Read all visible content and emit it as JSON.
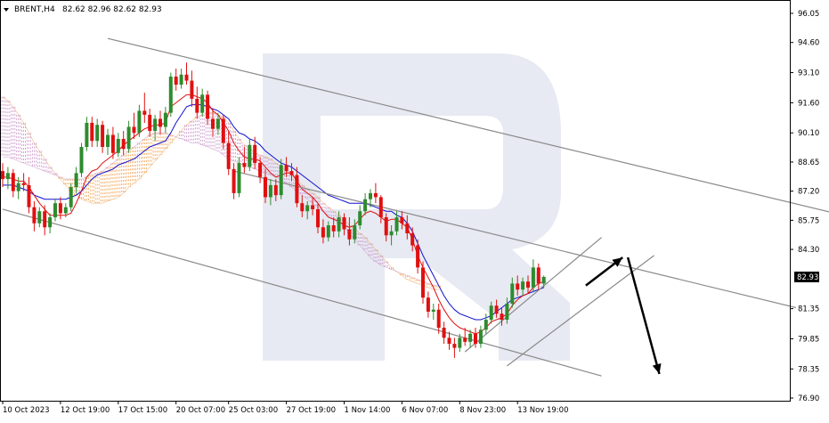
{
  "header": {
    "symbol_label": "BRENT,H4",
    "ohlc": "82.62 82.96 82.62 82.93"
  },
  "colors": {
    "bull": "#2e8b2e",
    "bear": "#e01010",
    "tenkan": "#e01010",
    "kijun": "#1010d0",
    "cloud_up": "#c890c8",
    "cloud_down": "#f0a050",
    "channel": "#8a8a8a",
    "arrow": "#000000",
    "watermark": "#dfe3ee",
    "axis": "#000000",
    "price_box": "#000000"
  },
  "icons": {
    "dropdown": "dropdown-triangle-icon"
  },
  "chart_data": {
    "type": "candlestick",
    "symbol": "BRENT",
    "timeframe": "H4",
    "ylim": [
      76.9,
      96.05
    ],
    "y_ticks": [
      "96.05",
      "94.60",
      "93.10",
      "91.60",
      "90.10",
      "88.65",
      "87.20",
      "85.75",
      "84.30",
      "82.93",
      "81.35",
      "79.85",
      "78.35",
      "76.90"
    ],
    "x_ticks": [
      "10 Oct 2023",
      "12 Oct 19:00",
      "17 Oct 15:00",
      "20 Oct 07:00",
      "25 Oct 03:00",
      "27 Oct 19:00",
      "1 Nov 14:00",
      "6 Nov 07:00",
      "8 Nov 23:00",
      "13 Nov 19:00"
    ],
    "current_price": "82.93",
    "candles": [
      {
        "o": 88.2,
        "h": 88.6,
        "l": 87.4,
        "c": 87.8
      },
      {
        "o": 87.8,
        "h": 88.4,
        "l": 87.3,
        "c": 88.1
      },
      {
        "o": 88.1,
        "h": 88.3,
        "l": 86.9,
        "c": 87.2
      },
      {
        "o": 87.2,
        "h": 87.9,
        "l": 86.8,
        "c": 87.6
      },
      {
        "o": 87.6,
        "h": 88.1,
        "l": 87.2,
        "c": 87.5
      },
      {
        "o": 87.5,
        "h": 87.9,
        "l": 86.1,
        "c": 86.4
      },
      {
        "o": 86.4,
        "h": 86.7,
        "l": 85.2,
        "c": 85.6
      },
      {
        "o": 85.6,
        "h": 86.4,
        "l": 85.4,
        "c": 86.2
      },
      {
        "o": 86.2,
        "h": 86.5,
        "l": 85.0,
        "c": 85.4
      },
      {
        "o": 85.4,
        "h": 86.1,
        "l": 85.1,
        "c": 85.9
      },
      {
        "o": 85.9,
        "h": 86.8,
        "l": 85.7,
        "c": 86.6
      },
      {
        "o": 86.6,
        "h": 86.9,
        "l": 85.8,
        "c": 86.1
      },
      {
        "o": 86.1,
        "h": 86.6,
        "l": 85.9,
        "c": 86.4
      },
      {
        "o": 86.4,
        "h": 87.6,
        "l": 86.2,
        "c": 87.4
      },
      {
        "o": 87.4,
        "h": 88.4,
        "l": 87.1,
        "c": 88.1
      },
      {
        "o": 88.1,
        "h": 89.6,
        "l": 87.9,
        "c": 89.4
      },
      {
        "o": 89.4,
        "h": 90.9,
        "l": 89.2,
        "c": 90.6
      },
      {
        "o": 90.6,
        "h": 90.9,
        "l": 89.4,
        "c": 89.7
      },
      {
        "o": 89.7,
        "h": 90.8,
        "l": 89.4,
        "c": 90.5
      },
      {
        "o": 90.5,
        "h": 90.7,
        "l": 89.1,
        "c": 89.4
      },
      {
        "o": 89.4,
        "h": 90.3,
        "l": 89.0,
        "c": 90.0
      },
      {
        "o": 90.0,
        "h": 90.4,
        "l": 88.8,
        "c": 89.1
      },
      {
        "o": 89.1,
        "h": 90.1,
        "l": 88.9,
        "c": 89.8
      },
      {
        "o": 89.8,
        "h": 90.2,
        "l": 89.0,
        "c": 89.3
      },
      {
        "o": 89.3,
        "h": 90.7,
        "l": 89.1,
        "c": 90.4
      },
      {
        "o": 90.4,
        "h": 91.1,
        "l": 89.8,
        "c": 90.1
      },
      {
        "o": 90.1,
        "h": 91.5,
        "l": 89.9,
        "c": 91.2
      },
      {
        "o": 91.2,
        "h": 92.1,
        "l": 90.6,
        "c": 91.0
      },
      {
        "o": 91.0,
        "h": 91.3,
        "l": 89.9,
        "c": 90.2
      },
      {
        "o": 90.2,
        "h": 91.0,
        "l": 89.7,
        "c": 90.8
      },
      {
        "o": 90.8,
        "h": 91.2,
        "l": 90.0,
        "c": 90.4
      },
      {
        "o": 90.4,
        "h": 91.4,
        "l": 90.1,
        "c": 91.1
      },
      {
        "o": 91.1,
        "h": 93.1,
        "l": 90.9,
        "c": 92.9
      },
      {
        "o": 92.9,
        "h": 93.3,
        "l": 92.2,
        "c": 92.5
      },
      {
        "o": 92.5,
        "h": 93.3,
        "l": 92.3,
        "c": 93.0
      },
      {
        "o": 93.0,
        "h": 93.6,
        "l": 92.5,
        "c": 92.7
      },
      {
        "o": 92.7,
        "h": 93.2,
        "l": 91.4,
        "c": 91.8
      },
      {
        "o": 91.8,
        "h": 92.4,
        "l": 90.8,
        "c": 91.1
      },
      {
        "o": 91.1,
        "h": 92.3,
        "l": 90.9,
        "c": 92.0
      },
      {
        "o": 92.0,
        "h": 92.2,
        "l": 90.5,
        "c": 90.8
      },
      {
        "o": 90.8,
        "h": 91.3,
        "l": 89.9,
        "c": 90.3
      },
      {
        "o": 90.3,
        "h": 91.1,
        "l": 90.0,
        "c": 90.8
      },
      {
        "o": 90.8,
        "h": 91.0,
        "l": 89.3,
        "c": 89.6
      },
      {
        "o": 89.6,
        "h": 90.2,
        "l": 88.0,
        "c": 88.3
      },
      {
        "o": 88.3,
        "h": 88.6,
        "l": 86.8,
        "c": 87.1
      },
      {
        "o": 87.1,
        "h": 88.9,
        "l": 86.9,
        "c": 88.6
      },
      {
        "o": 88.6,
        "h": 89.4,
        "l": 88.1,
        "c": 88.4
      },
      {
        "o": 88.4,
        "h": 89.8,
        "l": 88.2,
        "c": 89.5
      },
      {
        "o": 89.5,
        "h": 89.9,
        "l": 88.3,
        "c": 88.6
      },
      {
        "o": 88.6,
        "h": 88.9,
        "l": 87.6,
        "c": 87.9
      },
      {
        "o": 87.9,
        "h": 88.3,
        "l": 86.6,
        "c": 86.9
      },
      {
        "o": 86.9,
        "h": 87.8,
        "l": 86.5,
        "c": 87.5
      },
      {
        "o": 87.5,
        "h": 87.8,
        "l": 86.7,
        "c": 87.0
      },
      {
        "o": 87.0,
        "h": 88.8,
        "l": 86.8,
        "c": 88.5
      },
      {
        "o": 88.5,
        "h": 88.9,
        "l": 87.9,
        "c": 88.2
      },
      {
        "o": 88.2,
        "h": 88.6,
        "l": 87.7,
        "c": 88.0
      },
      {
        "o": 88.0,
        "h": 88.4,
        "l": 86.4,
        "c": 86.6
      },
      {
        "o": 86.6,
        "h": 87.0,
        "l": 85.9,
        "c": 86.2
      },
      {
        "o": 86.2,
        "h": 86.7,
        "l": 85.8,
        "c": 86.5
      },
      {
        "o": 86.5,
        "h": 86.9,
        "l": 86.0,
        "c": 86.3
      },
      {
        "o": 86.3,
        "h": 86.6,
        "l": 85.1,
        "c": 85.4
      },
      {
        "o": 85.4,
        "h": 85.8,
        "l": 84.6,
        "c": 84.9
      },
      {
        "o": 84.9,
        "h": 85.7,
        "l": 84.7,
        "c": 85.5
      },
      {
        "o": 85.5,
        "h": 85.9,
        "l": 84.9,
        "c": 85.2
      },
      {
        "o": 85.2,
        "h": 86.2,
        "l": 84.9,
        "c": 85.9
      },
      {
        "o": 85.9,
        "h": 86.1,
        "l": 85.0,
        "c": 85.3
      },
      {
        "o": 85.3,
        "h": 85.9,
        "l": 84.5,
        "c": 84.8
      },
      {
        "o": 84.8,
        "h": 85.8,
        "l": 84.6,
        "c": 85.5
      },
      {
        "o": 85.5,
        "h": 86.5,
        "l": 85.3,
        "c": 86.2
      },
      {
        "o": 86.2,
        "h": 87.1,
        "l": 86.0,
        "c": 86.8
      },
      {
        "o": 86.8,
        "h": 87.3,
        "l": 86.4,
        "c": 87.1
      },
      {
        "o": 87.1,
        "h": 87.6,
        "l": 86.6,
        "c": 86.9
      },
      {
        "o": 86.9,
        "h": 87.0,
        "l": 85.6,
        "c": 85.9
      },
      {
        "o": 85.9,
        "h": 86.1,
        "l": 84.7,
        "c": 85.0
      },
      {
        "o": 85.0,
        "h": 85.5,
        "l": 84.5,
        "c": 85.2
      },
      {
        "o": 85.2,
        "h": 86.2,
        "l": 85.0,
        "c": 85.9
      },
      {
        "o": 85.9,
        "h": 86.2,
        "l": 85.3,
        "c": 85.6
      },
      {
        "o": 85.6,
        "h": 86.0,
        "l": 84.8,
        "c": 85.1
      },
      {
        "o": 85.1,
        "h": 85.4,
        "l": 84.2,
        "c": 84.5
      },
      {
        "o": 84.5,
        "h": 84.8,
        "l": 83.1,
        "c": 83.4
      },
      {
        "o": 83.4,
        "h": 83.7,
        "l": 81.6,
        "c": 81.9
      },
      {
        "o": 81.9,
        "h": 82.2,
        "l": 80.9,
        "c": 81.2
      },
      {
        "o": 81.2,
        "h": 81.6,
        "l": 80.8,
        "c": 81.3
      },
      {
        "o": 81.3,
        "h": 81.6,
        "l": 80.1,
        "c": 80.4
      },
      {
        "o": 80.4,
        "h": 80.7,
        "l": 79.6,
        "c": 79.9
      },
      {
        "o": 79.9,
        "h": 80.2,
        "l": 79.3,
        "c": 79.6
      },
      {
        "o": 79.6,
        "h": 79.9,
        "l": 78.9,
        "c": 79.4
      },
      {
        "o": 79.4,
        "h": 80.1,
        "l": 79.2,
        "c": 79.9
      },
      {
        "o": 79.9,
        "h": 80.4,
        "l": 79.5,
        "c": 79.7
      },
      {
        "o": 79.7,
        "h": 80.3,
        "l": 79.4,
        "c": 80.1
      },
      {
        "o": 80.1,
        "h": 80.4,
        "l": 79.4,
        "c": 79.6
      },
      {
        "o": 79.6,
        "h": 80.5,
        "l": 79.4,
        "c": 80.3
      },
      {
        "o": 80.3,
        "h": 81.1,
        "l": 80.1,
        "c": 80.8
      },
      {
        "o": 80.8,
        "h": 81.7,
        "l": 80.6,
        "c": 81.5
      },
      {
        "o": 81.5,
        "h": 81.8,
        "l": 80.9,
        "c": 81.1
      },
      {
        "o": 81.1,
        "h": 81.4,
        "l": 80.5,
        "c": 80.8
      },
      {
        "o": 80.8,
        "h": 81.9,
        "l": 80.6,
        "c": 81.6
      },
      {
        "o": 81.6,
        "h": 82.9,
        "l": 81.4,
        "c": 82.6
      },
      {
        "o": 82.6,
        "h": 83.0,
        "l": 82.0,
        "c": 82.3
      },
      {
        "o": 82.3,
        "h": 82.9,
        "l": 82.0,
        "c": 82.7
      },
      {
        "o": 82.7,
        "h": 83.0,
        "l": 82.1,
        "c": 82.4
      },
      {
        "o": 82.4,
        "h": 83.8,
        "l": 82.2,
        "c": 83.4
      },
      {
        "o": 83.4,
        "h": 83.6,
        "l": 82.3,
        "c": 82.6
      },
      {
        "o": 82.6,
        "h": 83.0,
        "l": 82.4,
        "c": 82.93
      }
    ],
    "tenkan_sen": [
      87.9,
      87.9,
      87.8,
      87.7,
      87.7,
      87.4,
      87.0,
      86.6,
      86.3,
      86.0,
      86.0,
      86.0,
      86.0,
      86.1,
      86.6,
      87.2,
      87.9,
      88.2,
      88.3,
      88.6,
      88.8,
      89.0,
      89.2,
      89.5,
      89.7,
      89.9,
      90.1,
      90.3,
      90.4,
      90.5,
      90.5,
      90.6,
      91.4,
      91.6,
      91.8,
      92.0,
      92.0,
      91.9,
      91.8,
      91.6,
      91.2,
      91.0,
      90.6,
      90.2,
      89.6,
      89.2,
      88.9,
      88.8,
      88.8,
      88.7,
      88.4,
      88.1,
      87.9,
      88.0,
      88.1,
      88.1,
      87.7,
      87.3,
      87.1,
      86.9,
      86.6,
      86.2,
      85.9,
      85.8,
      85.7,
      85.5,
      85.4,
      85.5,
      85.8,
      86.1,
      86.2,
      86.1,
      85.9,
      85.7,
      85.8,
      85.8,
      85.6,
      85.4,
      84.8,
      84.0,
      83.4,
      82.9,
      82.4,
      81.8,
      81.3,
      80.9,
      80.6,
      80.4,
      80.3,
      80.2,
      80.1,
      80.2,
      80.4,
      80.7,
      80.8,
      80.9,
      81.1,
      81.5,
      81.8,
      82.0,
      82.1,
      82.4,
      82.6,
      82.7
    ],
    "kijun_sen": [
      87.5,
      87.5,
      87.5,
      87.4,
      87.3,
      87.2,
      87.0,
      86.9,
      86.8,
      86.8,
      86.8,
      86.8,
      86.8,
      86.9,
      87.0,
      87.2,
      87.5,
      87.8,
      88.0,
      88.1,
      88.2,
      88.3,
      88.5,
      88.6,
      88.7,
      88.8,
      89.0,
      89.2,
      89.4,
      89.5,
      89.6,
      89.7,
      90.1,
      90.6,
      91.0,
      91.4,
      91.5,
      91.5,
      91.5,
      91.4,
      91.3,
      91.2,
      91.0,
      90.8,
      90.4,
      90.1,
      90.0,
      89.8,
      89.7,
      89.5,
      89.2,
      89.0,
      88.8,
      88.6,
      88.5,
      88.4,
      88.2,
      88.0,
      87.8,
      87.6,
      87.4,
      87.2,
      87.0,
      86.9,
      86.8,
      86.7,
      86.6,
      86.6,
      86.6,
      86.6,
      86.5,
      86.4,
      86.3,
      86.2,
      86.2,
      86.0,
      85.9,
      85.6,
      85.2,
      84.6,
      84.0,
      83.5,
      83.0,
      82.5,
      82.0,
      81.6,
      81.3,
      81.1,
      81.0,
      80.9,
      80.8,
      80.8,
      80.9,
      81.0,
      81.2,
      81.4,
      81.6,
      81.8,
      81.9,
      82.0,
      82.1,
      82.2,
      82.3,
      82.4
    ],
    "cloud": {
      "span_a": [
        91.9,
        91.7,
        91.4,
        91.0,
        90.6,
        90.1,
        89.6,
        89.2,
        88.8,
        88.4,
        88.1,
        87.8,
        87.5,
        87.2,
        87.0,
        86.8,
        86.7,
        86.6,
        86.6,
        86.6,
        86.7,
        86.8,
        86.9,
        87.1,
        87.4,
        87.6,
        87.8,
        88.1,
        88.4,
        88.7,
        89.0,
        89.3,
        89.6,
        89.9,
        90.2,
        90.5,
        90.7,
        90.9,
        91.0,
        91.1,
        91.1,
        91.0,
        90.9,
        90.6,
        90.2,
        89.8,
        89.5,
        89.3,
        89.1,
        89.0,
        88.9,
        88.8,
        88.6,
        88.4,
        88.2,
        88.0,
        87.8,
        87.5,
        87.3,
        87.1,
        86.9,
        86.6,
        86.4,
        86.2,
        86.0,
        85.8,
        85.5,
        85.3,
        85.1,
        84.9,
        84.6,
        84.3,
        84.0,
        83.7,
        83.4,
        83.2,
        83.0,
        82.8,
        82.7,
        82.6,
        82.5,
        82.4,
        82.3,
        82.3
      ],
      "span_b": [
        88.9,
        88.9,
        88.8,
        88.7,
        88.6,
        88.5,
        88.4,
        88.3,
        88.2,
        88.1,
        88.0,
        87.9,
        87.8,
        87.8,
        87.8,
        87.8,
        87.9,
        88.0,
        88.1,
        88.2,
        88.4,
        88.6,
        88.8,
        89.0,
        89.2,
        89.4,
        89.6,
        89.8,
        90.0,
        90.1,
        90.1,
        90.1,
        90.0,
        89.9,
        89.8,
        89.7,
        89.6,
        89.6,
        89.5,
        89.4,
        89.3,
        89.2,
        89.0,
        88.8,
        88.7,
        88.6,
        88.5,
        88.4,
        88.3,
        88.2,
        88.1,
        88.0,
        87.9,
        87.8,
        87.6,
        87.4,
        87.2,
        87.0,
        86.8,
        86.6,
        86.4,
        86.2,
        86.0,
        85.8,
        85.6,
        85.4,
        85.1,
        84.8,
        84.5,
        84.2,
        83.9,
        83.7,
        83.5,
        83.4,
        83.3,
        83.2,
        83.1,
        83.0,
        82.9,
        82.8,
        82.7,
        82.6,
        82.5,
        82.5
      ]
    },
    "channels": [
      {
        "name": "",
        "points": [
          [
            0,
            86.3
          ],
          [
            114,
            78.0
          ]
        ]
      },
      {
        "name": "",
        "points": [
          [
            20,
            94.8
          ],
          [
            160,
            86.0
          ]
        ]
      },
      {
        "name": "",
        "points": [
          [
            44,
            88.2
          ],
          [
            151,
            81.4
          ]
        ]
      },
      {
        "name": "",
        "points": [
          [
            88,
            79.2
          ],
          [
            114,
            84.9
          ]
        ]
      },
      {
        "name": "",
        "points": [
          [
            96,
            78.5
          ],
          [
            124,
            84.0
          ]
        ]
      }
    ],
    "forecast_arrows": [
      {
        "from": [
          111,
          82.5
        ],
        "to": [
          118,
          83.9
        ]
      },
      {
        "from": [
          119,
          83.9
        ],
        "to": [
          125,
          78.1
        ]
      }
    ]
  }
}
